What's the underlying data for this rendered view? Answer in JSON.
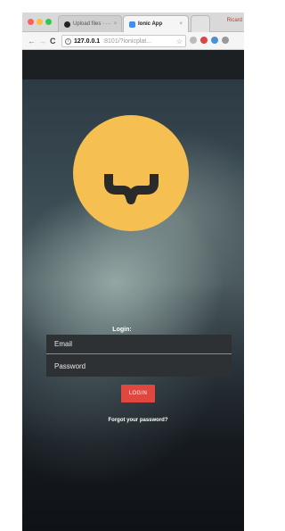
{
  "browser": {
    "tabs": [
      {
        "label": "Upload files · ···",
        "close": "×"
      },
      {
        "label": "Ionic App",
        "close": "×"
      }
    ],
    "profile": "Ricard",
    "nav": {
      "back": "←",
      "forward": "→",
      "reload": "C"
    },
    "url": {
      "info": "i",
      "host": "127.0.0.1",
      "rest": ":8101/?ionicplat...",
      "star": "☆"
    },
    "traffic_colors": [
      "#fc605c",
      "#fdbc40",
      "#34c84a"
    ]
  },
  "app": {
    "logo": {
      "icon": "brace-logo-icon",
      "color": "#f5bf52"
    },
    "login": {
      "title": "Login:",
      "email_placeholder": "Email",
      "password_placeholder": "Password",
      "button_label": "LOGIN",
      "button_color": "#e0473f",
      "forgot_label": "Forgot your password?"
    }
  }
}
